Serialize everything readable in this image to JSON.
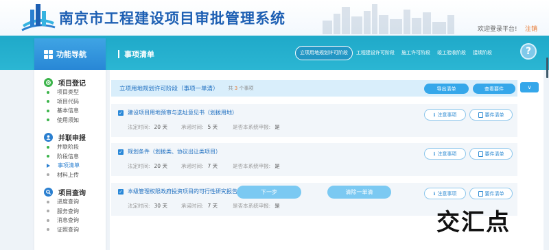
{
  "header": {
    "site_title": "南京市工程建设项目审批管理系统",
    "welcome": "欢迎登录平台!",
    "logout": "注销"
  },
  "sidebar": {
    "title": "功能导航",
    "groups": [
      {
        "label": "项目登记",
        "icon": "gear-icon",
        "color": "#3cb44b",
        "items": [
          {
            "label": "项目类型"
          },
          {
            "label": "项目代码"
          },
          {
            "label": "基本信息"
          },
          {
            "label": "使用须知"
          }
        ]
      },
      {
        "label": "并联申报",
        "icon": "user-icon",
        "color": "#2a7fd0",
        "items": [
          {
            "label": "并联阶段"
          },
          {
            "label": "阶段信息"
          },
          {
            "label": "事项清单",
            "active": true
          },
          {
            "label": "材料上传"
          }
        ]
      },
      {
        "label": "项目查询",
        "icon": "search-icon",
        "color": "#2a7fd0",
        "items": [
          {
            "label": "进度查询"
          },
          {
            "label": "服务查询"
          },
          {
            "label": "消息查询"
          },
          {
            "label": "证照查询"
          }
        ]
      }
    ]
  },
  "main": {
    "title": "事项清单",
    "stage_tabs": [
      {
        "label": "立项用地规划许可阶段",
        "active": true
      },
      {
        "label": "工程建设许可阶段"
      },
      {
        "label": "施工许可阶段"
      },
      {
        "label": "竣工验收阶段"
      },
      {
        "label": "接续阶段"
      }
    ],
    "help": "?",
    "summary": {
      "title": "立项用地规划许可阶段（事项一单清）",
      "count_prefix": "共",
      "count": "3",
      "count_suffix": "个事项",
      "export_label": "导出清单",
      "view_label": "查看要件",
      "expand_label": "∨"
    },
    "items": [
      {
        "title": "建设项目用地预审与选址意见书（划拨用地）",
        "legal_label": "法定时间:",
        "legal_value": "20 天",
        "promise_label": "承诺时间:",
        "promise_value": "5 天",
        "system_label": "是否本系统申报:",
        "system_value": "是",
        "notice_label": "注意事项",
        "materials_label": "要件清单"
      },
      {
        "title": "规划条件（划拨类、协议出让类项目）",
        "legal_label": "法定时间:",
        "legal_value": "20 天",
        "promise_label": "承诺时间:",
        "promise_value": "7 天",
        "system_label": "是否本系统申报:",
        "system_value": "是",
        "notice_label": "注意事项",
        "materials_label": "要件清单"
      },
      {
        "title": "本级管理权限政府投资项目的可行性研究报告审批",
        "legal_label": "法定时间:",
        "legal_value": "30 天",
        "promise_label": "承诺时间:",
        "promise_value": "7 天",
        "system_label": "是否本系统申报:",
        "system_value": "是",
        "notice_label": "注意事项",
        "materials_label": "要件清单"
      }
    ],
    "next_label": "下一步",
    "clear_label": "清除一单清"
  },
  "watermark": "交汇点",
  "colors": {
    "accent_teal": "#1fa9c9",
    "title_blue": "#1d5fb3",
    "button_blue": "#35a7ea",
    "logout_orange": "#e8742a"
  }
}
